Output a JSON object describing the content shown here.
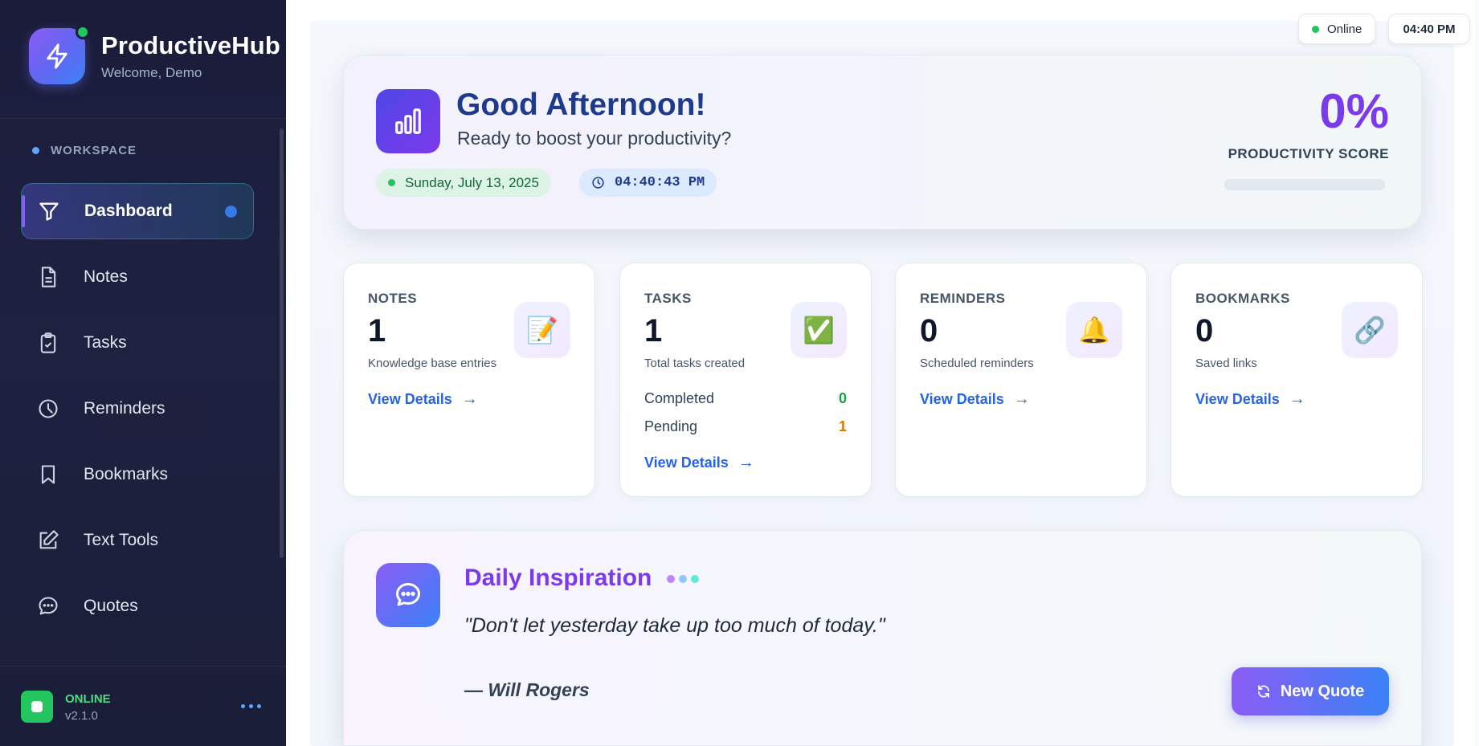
{
  "app": {
    "name": "ProductiveHub",
    "welcome": "Welcome, Demo"
  },
  "sidebar": {
    "section_label": "WORKSPACE",
    "items": [
      {
        "label": "Dashboard",
        "icon": "filter-icon",
        "active": true
      },
      {
        "label": "Notes",
        "icon": "document-icon"
      },
      {
        "label": "Tasks",
        "icon": "clipboard-check-icon"
      },
      {
        "label": "Reminders",
        "icon": "clock-icon"
      },
      {
        "label": "Bookmarks",
        "icon": "bookmark-icon"
      },
      {
        "label": "Text Tools",
        "icon": "edit-icon"
      },
      {
        "label": "Quotes",
        "icon": "chat-icon"
      }
    ],
    "footer": {
      "status": "ONLINE",
      "version": "v2.1.0"
    }
  },
  "topbar": {
    "status": "Online",
    "time": "04:40 PM"
  },
  "hero": {
    "greeting": "Good Afternoon!",
    "subtitle": "Ready to boost your productivity?",
    "date": "Sunday, July 13, 2025",
    "clock": "04:40:43 PM",
    "score_value": "0%",
    "score_label": "PRODUCTIVITY SCORE",
    "score_progress": 0
  },
  "cards": {
    "notes": {
      "label": "NOTES",
      "value": "1",
      "desc": "Knowledge base entries",
      "icon": "📝",
      "link": "View Details"
    },
    "tasks": {
      "label": "TASKS",
      "value": "1",
      "desc": "Total tasks created",
      "icon": "✅",
      "link": "View Details",
      "completed_label": "Completed",
      "completed_value": "0",
      "pending_label": "Pending",
      "pending_value": "1"
    },
    "reminders": {
      "label": "REMINDERS",
      "value": "0",
      "desc": "Scheduled reminders",
      "icon": "🔔",
      "link": "View Details"
    },
    "bookmarks": {
      "label": "BOOKMARKS",
      "value": "0",
      "desc": "Saved links",
      "icon": "🔗",
      "link": "View Details"
    }
  },
  "arrow": "→",
  "quote": {
    "title": "Daily Inspiration",
    "text": "\"Don't let yesterday take up too much of today.\"",
    "author": "— Will Rogers",
    "button": "New Quote"
  },
  "colors": {
    "accent_purple": "#7c3aed",
    "accent_blue": "#2563eb",
    "online_green": "#22c55e",
    "completed_green": "#16a34a",
    "pending_orange": "#d97706",
    "sidebar_bg": "#1a1c3a"
  }
}
